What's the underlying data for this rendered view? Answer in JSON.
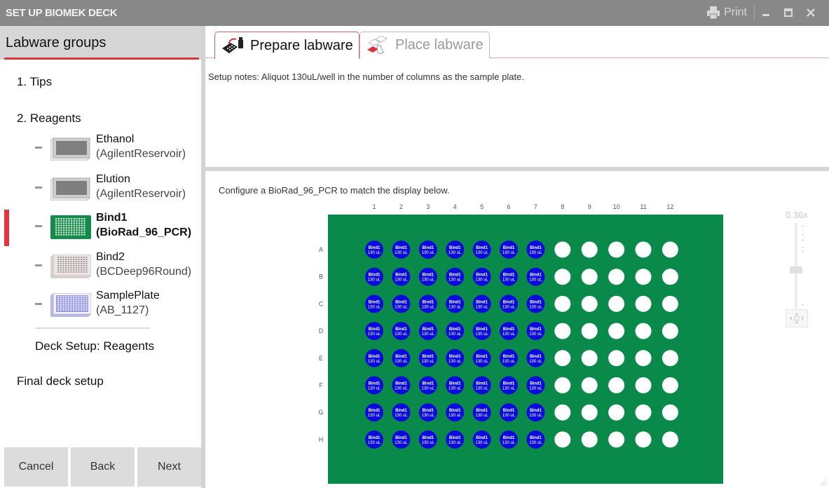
{
  "window": {
    "title": "SET UP BIOMEK DECK",
    "print_label": "Print",
    "minimize_icon": "minimize-icon",
    "maximize_icon": "maximize-icon",
    "close_icon": "close-icon"
  },
  "sidebar": {
    "header": "Labware groups",
    "steps": [
      {
        "label": "1. Tips"
      },
      {
        "label": "2. Reagents"
      }
    ],
    "reagents": [
      {
        "name": "Ethanol",
        "type": "(AgilentReservoir)",
        "thumb": "reservoir",
        "active": false
      },
      {
        "name": "Elution",
        "type": "(AgilentReservoir)",
        "thumb": "reservoir",
        "active": false
      },
      {
        "name": "Bind1",
        "type": "(BioRad_96_PCR)",
        "thumb": "pcr-plate-green",
        "active": true
      },
      {
        "name": "Bind2",
        "type": "(BCDeep96Round)",
        "thumb": "deepwell-plate",
        "active": false
      },
      {
        "name": "SamplePlate",
        "type": "(AB_1127)",
        "thumb": "sample-plate-blue",
        "active": false
      }
    ],
    "deck_setup_reagents": "Deck Setup: Reagents",
    "final_deck_setup": "Final deck setup",
    "buttons": {
      "cancel": "Cancel",
      "back": "Back",
      "next": "Next"
    }
  },
  "main": {
    "tabs": [
      {
        "label": "Prepare labware",
        "icon": "prepare-labware-icon",
        "active": true
      },
      {
        "label": "Place labware",
        "icon": "place-labware-icon",
        "active": false
      }
    ],
    "setup_notes": "Setup notes:  Aliquot 130uL/well in the number of columns as the sample plate.",
    "instruction": "Configure a BioRad_96_PCR to match the display below.",
    "plate": {
      "column_labels": [
        "1",
        "2",
        "3",
        "4",
        "5",
        "6",
        "7",
        "8",
        "9",
        "10",
        "11",
        "12"
      ],
      "row_labels": [
        "A",
        "B",
        "C",
        "D",
        "E",
        "F",
        "G",
        "H"
      ],
      "filled_columns": 7,
      "well_label_line1": "Bind1",
      "well_label_line2": "130 uL",
      "plate_color": "#0a8a4a",
      "filled_well_color": "#0a0adc",
      "empty_well_color": "#ffffff"
    },
    "zoom_level": "0.36x"
  },
  "colors": {
    "accent_red": "#d9343d",
    "titlebar": "#888888",
    "sidebar_header": "#d6d6d6"
  }
}
